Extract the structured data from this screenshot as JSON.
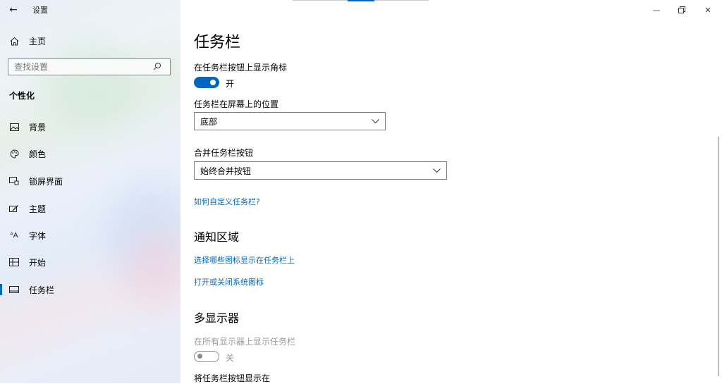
{
  "window": {
    "title": "设置",
    "back_icon": "back-arrow-icon",
    "controls": [
      "minimize-icon",
      "restore-icon",
      "close-icon"
    ]
  },
  "sidebar": {
    "home_label": "主页",
    "search_placeholder": "查找设置",
    "section_title": "个性化",
    "items": [
      {
        "label": "背景",
        "icon": "picture-icon"
      },
      {
        "label": "颜色",
        "icon": "palette-icon"
      },
      {
        "label": "锁屏界面",
        "icon": "lock-screen-icon"
      },
      {
        "label": "主题",
        "icon": "theme-brush-icon"
      },
      {
        "label": "字体",
        "icon": "font-icon"
      },
      {
        "label": "开始",
        "icon": "start-grid-icon"
      },
      {
        "label": "任务栏",
        "icon": "taskbar-icon",
        "active": true
      }
    ]
  },
  "main": {
    "title": "任务栏",
    "badges_label": "在任务栏按钮上显示角标",
    "badges_toggle": {
      "state": true,
      "text": "开"
    },
    "position_label": "任务栏在屏幕上的位置",
    "position_value": "底部",
    "combine_label": "合并任务栏按钮",
    "combine_value": "始终合并按钮",
    "customize_link": "如何自定义任务栏?",
    "notify_heading": "通知区域",
    "notify_link1": "选择哪些图标显示在任务栏上",
    "notify_link2": "打开或关闭系统图标",
    "multi_heading": "多显示器",
    "multi_label": "在所有显示器上显示任务栏",
    "multi_toggle": {
      "state": false,
      "text": "关"
    },
    "multi_buttons_label": "将任务栏按钮显示在"
  },
  "colors": {
    "accent": "#0067c0",
    "disabled": "#9a9a9a"
  }
}
